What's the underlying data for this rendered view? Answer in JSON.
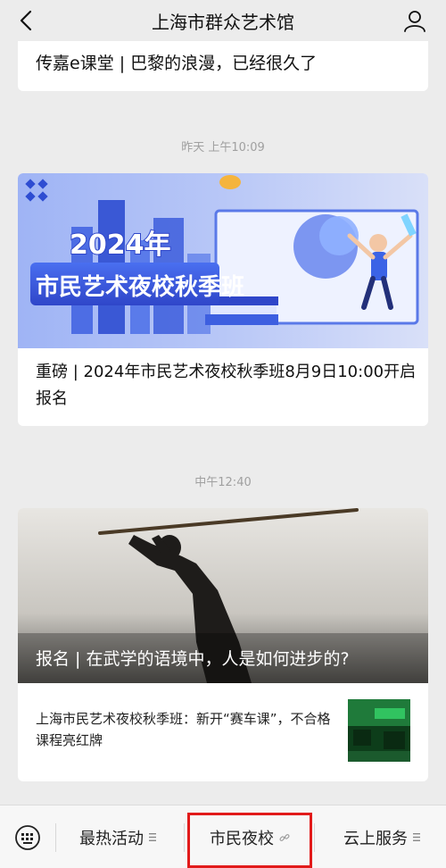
{
  "header": {
    "title": "上海市群众艺术馆"
  },
  "feed": {
    "item1": {
      "text": "传嘉e课堂 | 巴黎的浪漫，已经很久了"
    },
    "time1": "昨天 上午10:09",
    "item2": {
      "banner_year": "2024年",
      "banner_title": "市民艺术夜校秋季班",
      "caption": "重磅 | 2024年市民艺术夜校秋季班8月9日10:00开启报名"
    },
    "time2": "中午12:40",
    "item3": {
      "caption": "报名 | 在武学的语境中，人是如何进步的?",
      "sub_text": "上海市民艺术夜校秋季班：新开“赛车课”，不合格课程亮红牌"
    }
  },
  "bottom_menu": {
    "items": [
      {
        "label": "最热活动"
      },
      {
        "label": "市民夜校"
      },
      {
        "label": "云上服务"
      }
    ]
  },
  "colors": {
    "highlight": "#e21a1a",
    "banner_blue": "#3453d6",
    "background": "#ececec"
  }
}
